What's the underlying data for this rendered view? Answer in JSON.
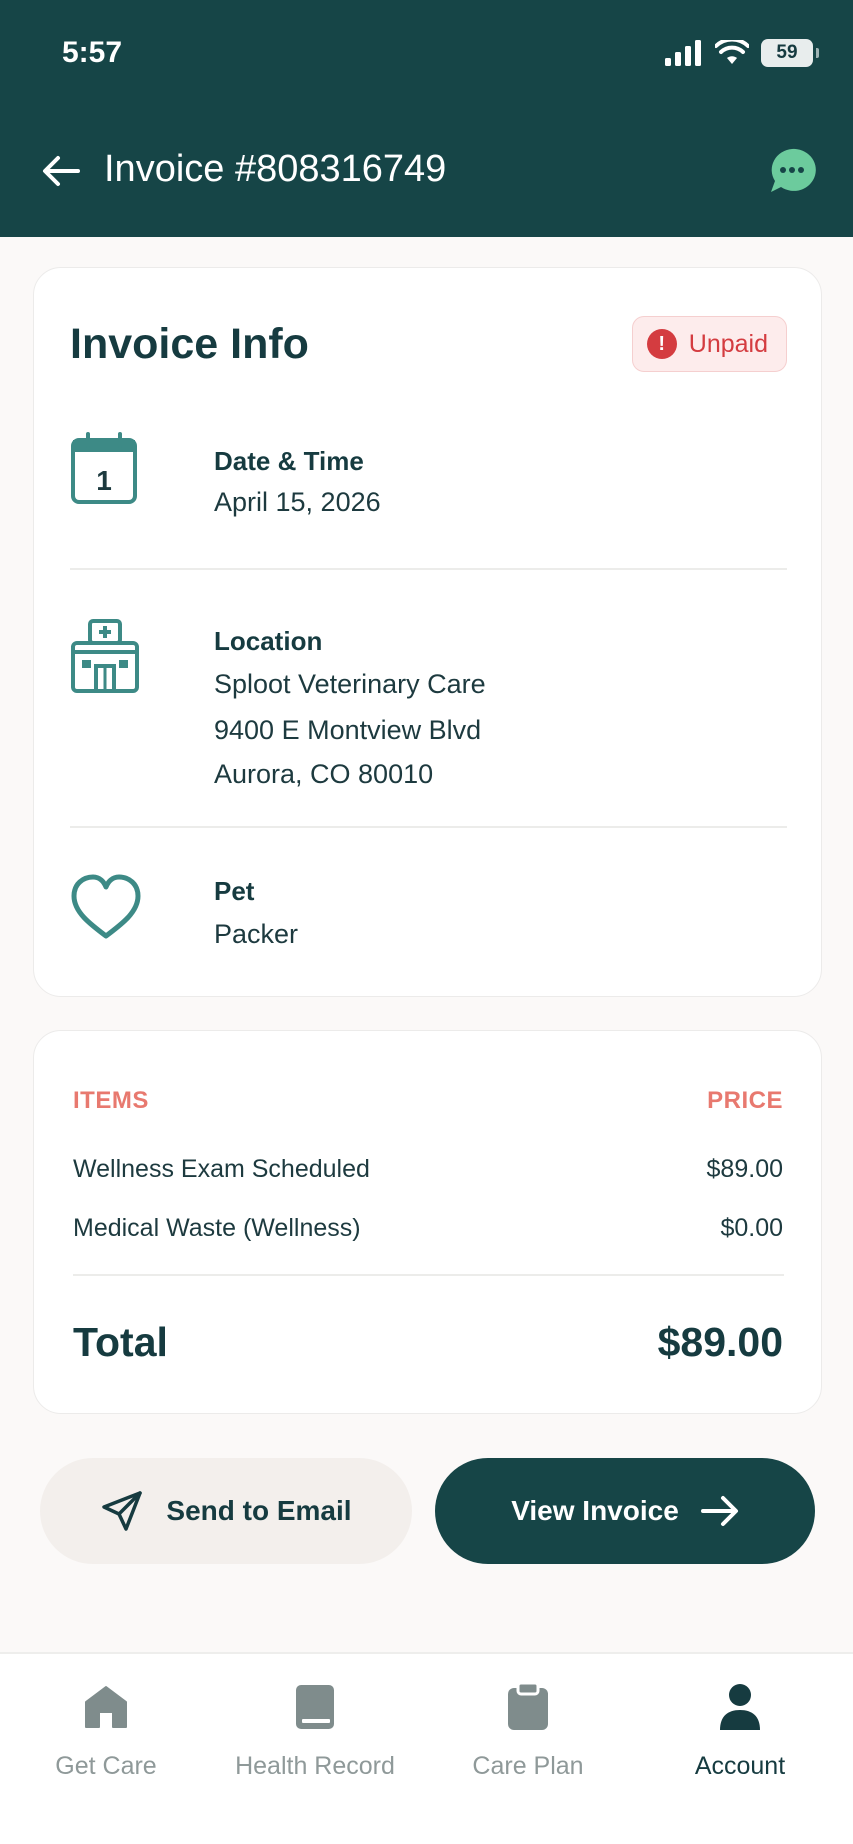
{
  "status_bar": {
    "time": "5:57",
    "battery": "59"
  },
  "header": {
    "title": "Invoice #808316749"
  },
  "invoice_info": {
    "title": "Invoice Info",
    "status_badge": "Unpaid",
    "date": {
      "label": "Date & Time",
      "value": "April 15, 2026",
      "icon_day": "1"
    },
    "location": {
      "label": "Location",
      "line1": "Sploot Veterinary Care",
      "line2": "9400 E Montview Blvd",
      "line3": "Aurora, CO 80010"
    },
    "pet": {
      "label": "Pet",
      "value": "Packer"
    }
  },
  "items": {
    "col_items": "ITEMS",
    "col_price": "PRICE",
    "rows": [
      {
        "name": "Wellness Exam Scheduled",
        "price": "$89.00"
      },
      {
        "name": "Medical Waste (Wellness)",
        "price": "$0.00"
      }
    ],
    "total_label": "Total",
    "total_value": "$89.00"
  },
  "actions": {
    "send_email": "Send to Email",
    "view_invoice": "View Invoice"
  },
  "bottom_nav": [
    {
      "label": "Get Care",
      "icon": "home-icon"
    },
    {
      "label": "Health Record",
      "icon": "book-icon"
    },
    {
      "label": "Care Plan",
      "icon": "clipboard-icon"
    },
    {
      "label": "Account",
      "icon": "person-icon",
      "active": true
    }
  ],
  "colors": {
    "header_bg": "#164547",
    "accent_coral": "#e8796f",
    "unpaid_red": "#d43c40",
    "icon_teal": "#3d8a86",
    "chat_green": "#6ccb9d"
  }
}
